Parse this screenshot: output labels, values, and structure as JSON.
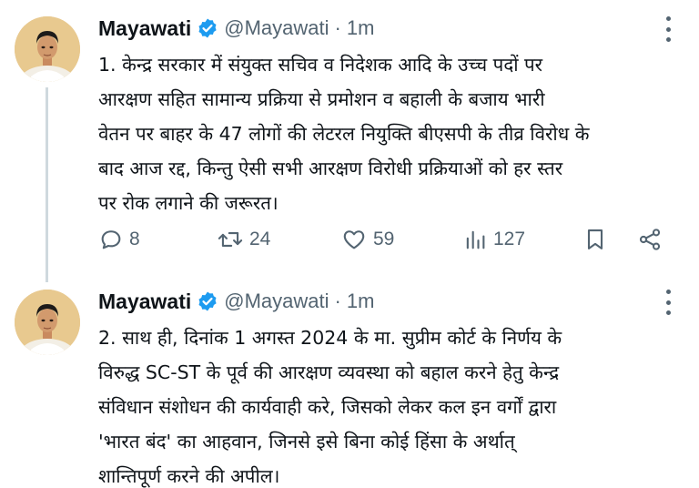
{
  "tweets": [
    {
      "author": {
        "name": "Mayawati",
        "handle": "@Mayawati",
        "verified_icon": "verified-badge-icon"
      },
      "separator": "·",
      "time": "1m",
      "lines": [
        "1. केन्द्र सरकार में संयुक्त सचिव व निदेशक आदि के उच्च पदों पर",
        "आरक्षण सहित सामान्य प्रक्रिया से प्रमोशन व बहाली के बजाय भारी",
        "वेतन पर बाहर के 47 लोगों की लेटरल नियुक्ति बीएसपी के तीव्र विरोध के",
        "बाद आज रद्द, किन्तु ऐसी सभी आरक्षण विरोधी प्रक्रियाओं को हर स्तर",
        "पर रोक लगाने की जरूरत।"
      ],
      "actions": {
        "replies": "8",
        "retweets": "24",
        "likes": "59",
        "views": "127"
      }
    },
    {
      "author": {
        "name": "Mayawati",
        "handle": "@Mayawati",
        "verified_icon": "verified-badge-icon"
      },
      "separator": "·",
      "time": "1m",
      "lines": [
        "2. साथ ही, दिनांक 1 अगस्त 2024 के मा. सुप्रीम कोर्ट के निर्णय के",
        "विरुद्ध SC-ST के पूर्व की आरक्षण व्यवस्था को बहाल करने हेतु केन्द्र",
        "संविधान संशोधन की कार्यवाही करे, जिसको लेकर कल इन वर्गों द्वारा",
        "'भारत बंद' का आहवान, जिनसे इसे बिना कोई हिंसा के अर्थात्",
        "शान्तिपूर्ण करने की अपील।"
      ]
    }
  ],
  "colors": {
    "text": "#0f1419",
    "muted": "#536471",
    "verified": "#1d9bf0",
    "thread_line": "#cfd9de"
  }
}
